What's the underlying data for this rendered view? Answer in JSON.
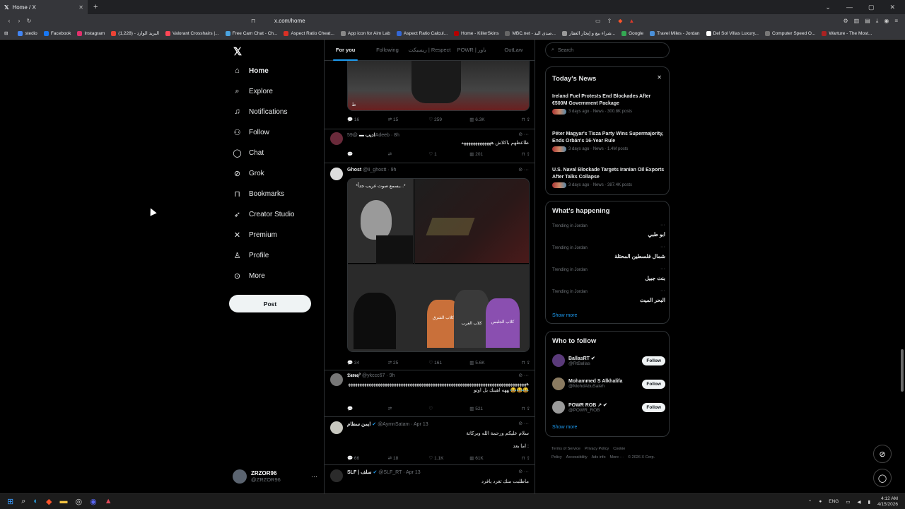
{
  "browser": {
    "tab_title": "Home / X",
    "tab_close": "✕",
    "new_tab": "+",
    "url": "x.com/home",
    "bookmarks": [
      {
        "label": "stedio",
        "color": "#4285f4"
      },
      {
        "label": "Facebook",
        "color": "#1877f2"
      },
      {
        "label": "Instagram",
        "color": "#e1306c"
      },
      {
        "label": "البريد الوارد - (1,228)",
        "color": "#ea4335"
      },
      {
        "label": "Valorant Crosshairs |...",
        "color": "#ff4655"
      },
      {
        "label": "Free Cam Chat - Ch...",
        "color": "#4aa3df"
      },
      {
        "label": "Aspect Ratio Cheat...",
        "color": "#d93025"
      },
      {
        "label": "App icon for Aim Lab",
        "color": "#888888"
      },
      {
        "label": "Aspect Ratio Calcul...",
        "color": "#3367d6"
      },
      {
        "label": "Home - KillerSkins",
        "color": "#b30000"
      },
      {
        "label": "MBC.net - صدى البد...",
        "color": "#666666"
      },
      {
        "label": "شراء بيع و إيجار العقار...",
        "color": "#999999"
      },
      {
        "label": "Google",
        "color": "#34a853"
      },
      {
        "label": "Travel Miles - Jordan",
        "color": "#4a90d9"
      },
      {
        "label": "Del Sol Villas Luxury...",
        "color": "#ffffff"
      },
      {
        "label": "Computer Speed O...",
        "color": "#777777"
      },
      {
        "label": "Warture - The Most...",
        "color": "#aa2222"
      }
    ]
  },
  "nav": {
    "items": [
      {
        "label": "Home",
        "icon": "home-icon",
        "glyph": "⌂"
      },
      {
        "label": "Explore",
        "icon": "search-icon",
        "glyph": "⌕"
      },
      {
        "label": "Notifications",
        "icon": "bell-icon",
        "glyph": "♫"
      },
      {
        "label": "Follow",
        "icon": "person-add-icon",
        "glyph": "⚇"
      },
      {
        "label": "Chat",
        "icon": "chat-icon",
        "glyph": "◯"
      },
      {
        "label": "Grok",
        "icon": "grok-icon",
        "glyph": "⊘"
      },
      {
        "label": "Bookmarks",
        "icon": "bookmark-icon",
        "glyph": "⊓"
      },
      {
        "label": "Creator Studio",
        "icon": "rocket-icon",
        "glyph": "➶"
      },
      {
        "label": "Premium",
        "icon": "x-icon",
        "glyph": "✕"
      },
      {
        "label": "Profile",
        "icon": "person-icon",
        "glyph": "♙"
      },
      {
        "label": "More",
        "icon": "more-icon",
        "glyph": "⊙"
      }
    ],
    "post_label": "Post",
    "account": {
      "name": "ZRZOR96",
      "handle": "@ZRZOR96",
      "more": "···"
    }
  },
  "feed": {
    "tabs": [
      "For you",
      "Following",
      "ريسبكت | Respect",
      "POWR | باور",
      "OutLaw"
    ],
    "posts": [
      {
        "stats": {
          "replies": "16",
          "reposts": "15",
          "likes": "259",
          "views": "6.3K"
        }
      },
      {
        "name": "اديب ▬",
        "handle": "@59Adeeb · 8h",
        "text": "ظاعطهم باكلاش هههههههههههههه",
        "stats": {
          "replies": "",
          "reposts": "",
          "likes": "1",
          "views": "201"
        }
      },
      {
        "name": "Ghost",
        "handle": "@ii_ghostt · 9h",
        "image_caption": "*يسمع صوت غريب جداً...*",
        "labels": [
          "كلاب الشرق",
          "كلاب الغرب",
          "كلاب الجلبس"
        ],
        "stats": {
          "replies": "34",
          "reposts": "25",
          "likes": "161",
          "views": "5.6K"
        }
      },
      {
        "name": "𝕿𝖆𝖗𝖊𝖖ˀ",
        "handle": "@ykccc67 · 9h",
        "text": "هههههههههههههههههههههههههههههههههههههههههههههههههههههههههههههههههههههههههههههههههه اهينك بل اوتو 😂😂😂",
        "stats": {
          "replies": "",
          "reposts": "",
          "likes": "",
          "views": "521"
        }
      },
      {
        "name": "ايمن سطام",
        "handle": "@AymnSatam · Apr 13",
        "text": "سلام عليكم ورحمة الله وبركاتة",
        "text2": "اما بعد :",
        "stats": {
          "replies": "66",
          "reposts": "18",
          "likes": "1.1K",
          "views": "61K"
        }
      },
      {
        "name": "SLF | سلف",
        "handle": "@SLF_RT · Apr 13",
        "text": "ماطلبت منك تغرد يافرد"
      }
    ]
  },
  "right": {
    "search_placeholder": "Search",
    "news_title": "Today's News",
    "news_close": "✕",
    "news": [
      {
        "title": "Ireland Fuel Protests End Blockades After €500M Government Package",
        "meta": "3 days ago · News · 300.8K posts"
      },
      {
        "title": "Péter Magyar's Tisza Party Wins Supermajority, Ends Orbán's 16-Year Rule",
        "meta": "3 days ago · News · 1.4M posts"
      },
      {
        "title": "U.S. Naval Blockade Targets Iranian Oil Exports After Talks Collapse",
        "meta": "3 days ago · News · 387.4K posts"
      }
    ],
    "happening_title": "What's happening",
    "trends": [
      {
        "location": "Trending in Jordan",
        "name": "ابو طبي"
      },
      {
        "location": "Trending in Jordan",
        "name": "شمال فلسطين المحتلة"
      },
      {
        "location": "Trending in Jordan",
        "name": "بنت جبيل"
      },
      {
        "location": "Trending in Jordan",
        "name": "البحر الميت"
      }
    ],
    "show_more": "Show more",
    "who_title": "Who to follow",
    "who": [
      {
        "name": "BallasRT ✔",
        "handle": "@RtBallas",
        "color": "#5a3a7a"
      },
      {
        "name": "Mohammed S Alkhalifa",
        "handle": "@MohdAbuSaleh",
        "color": "#8a7a60"
      },
      {
        "name": "POWR ROB ↗ ✔",
        "handle": "@POWR_ROB",
        "color": "#9a9a9a"
      }
    ],
    "follow_label": "Follow",
    "footer": [
      "Terms of Service",
      "Privacy Policy",
      "Cookie Policy",
      "Accessibility",
      "Ads info",
      "More ···",
      "© 2026 X Corp."
    ]
  },
  "taskbar": {
    "lang": "ENG",
    "time": "4:12 AM",
    "date": "4/15/2026"
  }
}
